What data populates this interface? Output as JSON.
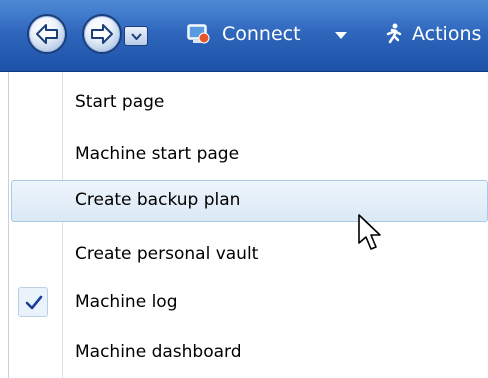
{
  "toolbar": {
    "back_icon": "back-arrow-icon",
    "forward_icon": "forward-arrow-icon",
    "history_icon": "chevron-down-icon",
    "connect_label": "Connect",
    "connect_icon": "computer-connect-icon",
    "actions_label": "Actions",
    "actions_icon": "running-man-icon",
    "colors": {
      "gradient_top": "#4f8ad6",
      "gradient_bottom": "#1d52a8",
      "text": "#ffffff"
    }
  },
  "menu": {
    "items": [
      {
        "label": "Start page",
        "checked": false,
        "highlighted": false
      },
      {
        "label": "Machine start page",
        "checked": false,
        "highlighted": false
      },
      {
        "label": "Create backup plan",
        "checked": false,
        "highlighted": true
      },
      {
        "label": "Create personal vault",
        "checked": false,
        "highlighted": false
      },
      {
        "label": "Machine log",
        "checked": true,
        "highlighted": false
      },
      {
        "label": "Machine dashboard",
        "checked": false,
        "highlighted": false
      }
    ],
    "check_icon": "checkmark-icon",
    "colors": {
      "highlight": "#dbe9f6",
      "highlight_border": "#a9c7e6",
      "check": "#1a3f9a"
    }
  },
  "cursor": {
    "icon": "mouse-pointer-icon"
  }
}
